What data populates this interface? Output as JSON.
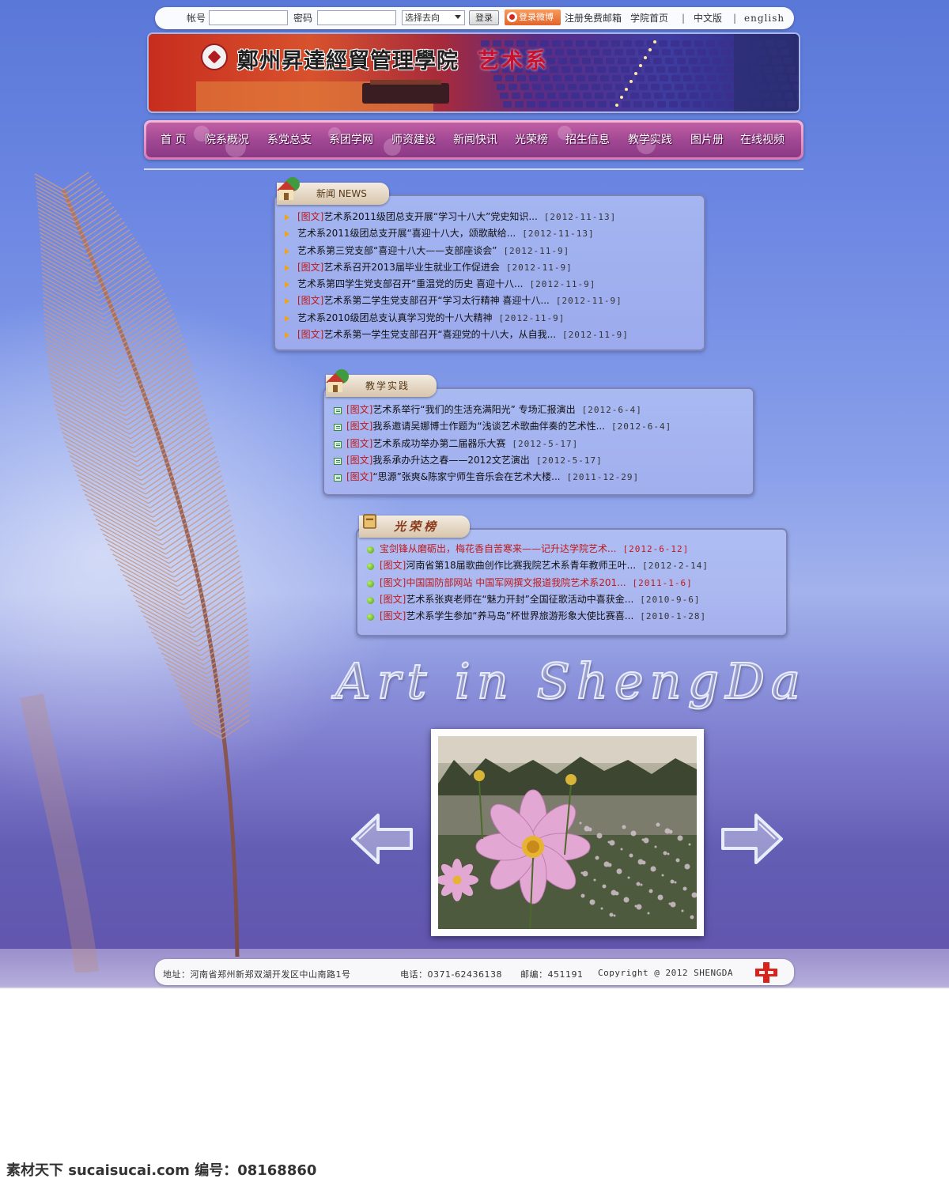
{
  "topbar": {
    "account_label": "帐号",
    "password_label": "密码",
    "goto_select": "选择去向",
    "login_button": "登录",
    "weibo_button": "登录微博",
    "links": [
      "注册免费邮箱",
      "学院首页",
      "|",
      "中文版",
      "|",
      "english"
    ]
  },
  "banner": {
    "school_name": "鄭州昇達經貿管理學院",
    "department": "艺术系"
  },
  "nav": {
    "items": [
      "首 页",
      "院系概况",
      "系党总支",
      "系团学网",
      "师资建设",
      "新闻快讯",
      "光荣榜",
      "招生信息",
      "教学实践",
      "图片册",
      "在线视频"
    ]
  },
  "news": {
    "title": "新闻 NEWS",
    "items": [
      {
        "tag": "[图文]",
        "text": "艺术系2011级团总支开展“学习十八大”党史知识...",
        "date": "[2012-11-13]"
      },
      {
        "tag": "",
        "text": "艺术系2011级团总支开展“喜迎十八大，颂歌献给...",
        "date": "[2012-11-13]"
      },
      {
        "tag": "",
        "text": "艺术系第三党支部“喜迎十八大——支部座谈会”",
        "date": "[2012-11-9]"
      },
      {
        "tag": "[图文]",
        "text": "艺术系召开2013届毕业生就业工作促进会",
        "date": "[2012-11-9]"
      },
      {
        "tag": "",
        "text": "艺术系第四学生党支部召开“重温党的历史 喜迎十八...",
        "date": "[2012-11-9]"
      },
      {
        "tag": "[图文]",
        "text": "艺术系第二学生党支部召开“学习太行精神 喜迎十八...",
        "date": "[2012-11-9]"
      },
      {
        "tag": "",
        "text": "艺术系2010级团总支认真学习党的十八大精神",
        "date": "[2012-11-9]"
      },
      {
        "tag": "[图文]",
        "text": "艺术系第一学生党支部召开“喜迎党的十八大，从自我...",
        "date": "[2012-11-9]"
      }
    ]
  },
  "practice": {
    "title": "教学实践",
    "items": [
      {
        "tag": "[图文]",
        "text": "艺术系举行“我们的生活充满阳光” 专场汇报演出",
        "date": "[2012-6-4]"
      },
      {
        "tag": "[图文]",
        "text": "我系邀请吴娜博士作题为“浅谈艺术歌曲伴奏的艺术性...",
        "date": "[2012-6-4]"
      },
      {
        "tag": "[图文]",
        "text": "艺术系成功举办第二届器乐大赛",
        "date": "[2012-5-17]"
      },
      {
        "tag": "[图文]",
        "text": "我系承办升达之春——2012文艺演出",
        "date": "[2012-5-17]"
      },
      {
        "tag": "[图文]",
        "text": "“思源”张爽&陈家宁师生音乐会在艺术大楼...",
        "date": "[2011-12-29]"
      }
    ]
  },
  "honor": {
    "title": "光荣榜",
    "items": [
      {
        "tag": "",
        "text": "宝剑锋从磨砺出，梅花香自苦寒来——记升达学院艺术...",
        "date": "[2012-6-12]",
        "highlight": true
      },
      {
        "tag": "[图文]",
        "text": "河南省第18届歌曲创作比赛我院艺术系青年教师王叶...",
        "date": "[2012-2-14]",
        "highlight": false
      },
      {
        "tag": "[图文]",
        "text": "中国国防部网站 中国军网撰文报道我院艺术系201...",
        "date": "[2011-1-6]",
        "highlight": true
      },
      {
        "tag": "[图文]",
        "text": "艺术系张爽老师在“魅力开封”全国征歌活动中喜获金...",
        "date": "[2010-9-6]",
        "highlight": false
      },
      {
        "tag": "[图文]",
        "text": "艺术系学生参加“养马岛”杯世界旅游形象大使比赛喜...",
        "date": "[2010-1-28]",
        "highlight": false
      }
    ]
  },
  "gallery": {
    "art_title": "Art in ShengDa",
    "prev_icon": "left-arrow-icon",
    "next_icon": "right-arrow-icon"
  },
  "footer": {
    "address": "地址：河南省郑州新郑双湖开发区中山南路1号",
    "phone": "电话：0371-62436138",
    "postcode": "邮编：451191",
    "copyright": "Copyright @ 2012 SHENGDA"
  },
  "watermark": "素材天下 sucaisucai.com  编号：08168860",
  "colors": {
    "accent_red": "#c01818",
    "nav_purple": "#a24894",
    "panel_border": "#7c84b5"
  }
}
